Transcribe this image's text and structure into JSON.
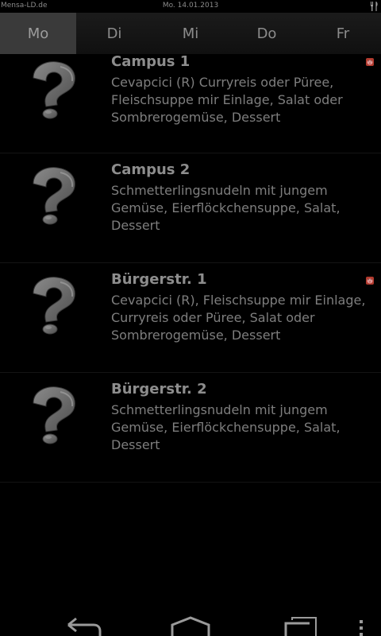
{
  "status_bar": {
    "app_name": "Mensa-LD.de",
    "date": "Mo. 14.01.2013",
    "icon": "cutlery-icon"
  },
  "tabs": [
    {
      "label": "Mo",
      "selected": true
    },
    {
      "label": "Di",
      "selected": false
    },
    {
      "label": "Mi",
      "selected": false
    },
    {
      "label": "Do",
      "selected": false
    },
    {
      "label": "Fr",
      "selected": false
    }
  ],
  "menus": [
    {
      "title": "Campus 1",
      "description": "Cevapcici (R) Curryreis oder Püree, Fleischsuppe mir Einlage, Salat oder Sombrerogemüse, Dessert",
      "icon": "question-mark-icon",
      "flag": "pig-icon"
    },
    {
      "title": "Campus 2",
      "description": "Schmetterlingsnudeln mit jungem Gemüse, Eierflöckchensuppe, Salat, Dessert",
      "icon": "question-mark-icon"
    },
    {
      "title": "Bürgerstr. 1",
      "description": "Cevapcici (R), Fleischsuppe mir Einlage, Curryreis oder Püree, Salat oder Sombrerogemüse, Dessert",
      "icon": "question-mark-icon",
      "flag": "pig-icon"
    },
    {
      "title": "Bürgerstr. 2",
      "description": "Schmetterlingsnudeln mit jungem Gemüse, Eierflöckchensuppe, Salat, Dessert",
      "icon": "question-mark-icon"
    }
  ],
  "nav_bar": {
    "buttons": [
      "back-icon",
      "home-icon",
      "recent-apps-icon",
      "overflow-menu-icon"
    ]
  },
  "colors": {
    "background": "#000000",
    "selected_tab": "#3a3a3a",
    "text": "#8d8d8d",
    "flag": "#c0392b"
  }
}
